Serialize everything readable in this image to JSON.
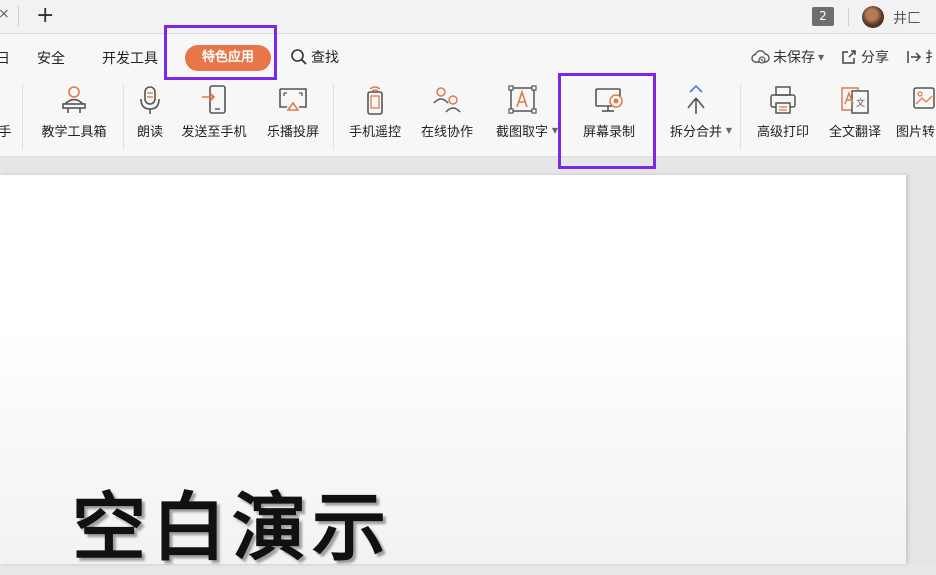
{
  "tabbar": {
    "edge_glyph": "×",
    "new_tab": "+",
    "window_count": "2",
    "username": "井匚"
  },
  "menu": {
    "edge_item": "日",
    "items": [
      "安全",
      "开发工具"
    ],
    "active": "特色应用",
    "search": "查找",
    "save_status": "未保存",
    "share": "分享",
    "far_right_partial": "扌"
  },
  "ribbon": {
    "items": [
      {
        "label": "手",
        "icon": "hand-edge-icon"
      },
      {
        "label": "教学工具箱",
        "icon": "teacher-icon"
      },
      {
        "label": "朗读",
        "icon": "microphone-icon"
      },
      {
        "label": "发送至手机",
        "icon": "send-to-phone-icon"
      },
      {
        "label": "乐播投屏",
        "icon": "screen-cast-icon"
      },
      {
        "label": "手机遥控",
        "icon": "phone-remote-icon"
      },
      {
        "label": "在线协作",
        "icon": "collaboration-icon"
      },
      {
        "label": "截图取字",
        "icon": "ocr-icon"
      },
      {
        "label": "屏幕录制",
        "icon": "screen-record-icon"
      },
      {
        "label": "拆分合并",
        "icon": "split-merge-icon"
      },
      {
        "label": "高级打印",
        "icon": "printer-icon"
      },
      {
        "label": "全文翻译",
        "icon": "translate-icon"
      },
      {
        "label": "图片转",
        "icon": "image-convert-icon"
      }
    ]
  },
  "slide": {
    "title": "空白演示"
  },
  "colors": {
    "accent_orange": "#e8764a",
    "highlight_purple": "#7b28e6"
  }
}
